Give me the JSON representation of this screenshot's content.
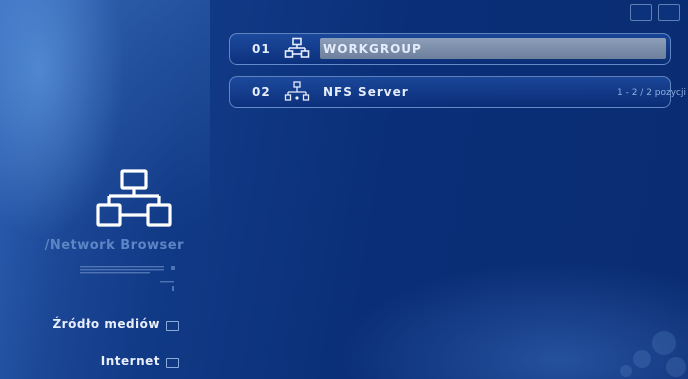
{
  "list": {
    "items": [
      {
        "number": "01",
        "icon": "workgroup-network-icon",
        "label": "WORKGROUP",
        "selected": true
      },
      {
        "number": "02",
        "icon": "nfs-server-icon",
        "label": "NFS Server",
        "selected": false
      }
    ],
    "count": "1 - 2 / 2 pozycji"
  },
  "module": {
    "title": "/Network Browser",
    "icon": "network-browser-icon"
  },
  "menu": {
    "items": [
      {
        "label": "Źródło mediów",
        "icon": "checkbox-icon"
      },
      {
        "label": "Internet",
        "icon": "checkbox-icon"
      }
    ]
  },
  "colors": {
    "accent": "#7f93b3",
    "background": "#0a2f78",
    "text": "#e4ecfb"
  }
}
